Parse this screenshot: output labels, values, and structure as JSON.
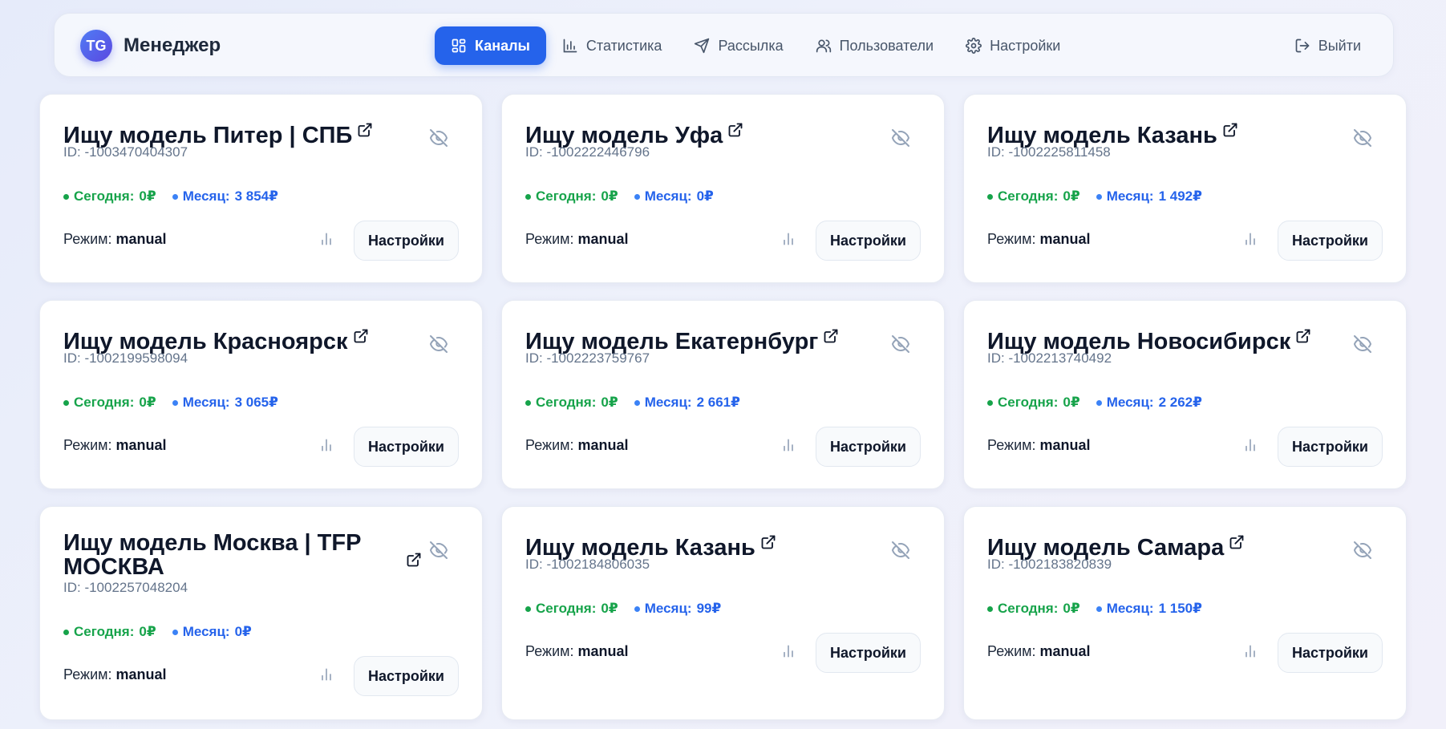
{
  "header": {
    "logo_text": "TG",
    "app_name": "Менеджер",
    "nav": [
      {
        "label": "Каналы",
        "icon": "grid-icon",
        "active": true
      },
      {
        "label": "Статистика",
        "icon": "bar-chart-icon",
        "active": false
      },
      {
        "label": "Рассылка",
        "icon": "send-icon",
        "active": false
      },
      {
        "label": "Пользователи",
        "icon": "users-icon",
        "active": false
      },
      {
        "label": "Настройки",
        "icon": "gear-icon",
        "active": false
      }
    ],
    "logout_label": "Выйти"
  },
  "colors": {
    "accent": "#2563eb",
    "today": "#16a34a",
    "month": "#2563eb"
  },
  "labels": {
    "today_prefix": "Сегодня:",
    "month_prefix": "Месяц:",
    "mode_prefix": "Режим:",
    "settings_button": "Настройки"
  },
  "channels": [
    {
      "title": "Ищу модель Питер | СПБ",
      "id": "ID: -1003470404307",
      "today": "0₽",
      "month": "3 854₽",
      "mode": "manual"
    },
    {
      "title": "Ищу модель Уфа",
      "id": "ID: -1002222446796",
      "today": "0₽",
      "month": "0₽",
      "mode": "manual"
    },
    {
      "title": "Ищу модель Казань",
      "id": "ID: -1002225811458",
      "today": "0₽",
      "month": "1 492₽",
      "mode": "manual"
    },
    {
      "title": "Ищу модель Красноярск",
      "id": "ID: -1002199598094",
      "today": "0₽",
      "month": "3 065₽",
      "mode": "manual"
    },
    {
      "title": "Ищу модель Екатернбург",
      "id": "ID: -1002223759767",
      "today": "0₽",
      "month": "2 661₽",
      "mode": "manual"
    },
    {
      "title": "Ищу модель Новосибирск",
      "id": "ID: -1002213740492",
      "today": "0₽",
      "month": "2 262₽",
      "mode": "manual"
    },
    {
      "title": "Ищу модель Москва | TFP МОСКВА",
      "id": "ID: -1002257048204",
      "today": "0₽",
      "month": "0₽",
      "mode": "manual"
    },
    {
      "title": "Ищу модель Казань",
      "id": "ID: -1002184806035",
      "today": "0₽",
      "month": "99₽",
      "mode": "manual"
    },
    {
      "title": "Ищу модель Самара",
      "id": "ID: -1002183820839",
      "today": "0₽",
      "month": "1 150₽",
      "mode": "manual"
    }
  ]
}
